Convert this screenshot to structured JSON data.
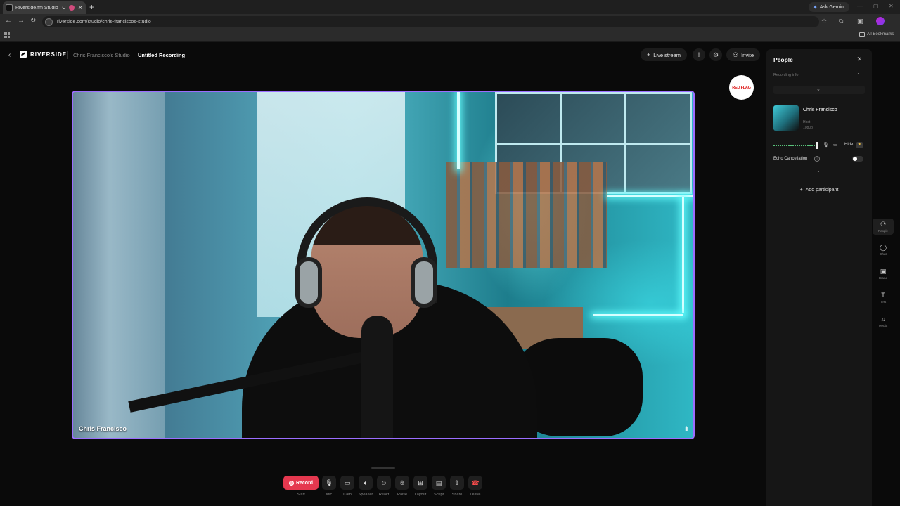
{
  "browser": {
    "tab_title": "Riverside.fm Studio | Chris F",
    "new_tab": "+",
    "ask_gemini": "Ask Gemini",
    "url": "riverside.com/studio/chris-franciscos-studio",
    "all_bookmarks": "All Bookmarks"
  },
  "header": {
    "brand": "RIVERSIDE",
    "studio_name": "Chris Francisco's Studio",
    "recording_name": "Untitled Recording",
    "live_stream": "Live stream",
    "invite": "Invite"
  },
  "stage": {
    "participant_name": "Chris Francisco",
    "overlay_logo_text": "RED FLAG"
  },
  "controls": [
    {
      "label": "Start",
      "button": "Record",
      "icon": "record-dot"
    },
    {
      "label": "Mic",
      "icon": "mic-icon"
    },
    {
      "label": "Cam",
      "icon": "camera-icon"
    },
    {
      "label": "Speaker",
      "icon": "speaker-icon"
    },
    {
      "label": "React",
      "icon": "emoji-icon"
    },
    {
      "label": "Raise",
      "icon": "hand-icon"
    },
    {
      "label": "Layout",
      "icon": "layout-icon"
    },
    {
      "label": "Script",
      "icon": "script-icon"
    },
    {
      "label": "Share",
      "icon": "share-icon"
    },
    {
      "label": "Leave",
      "icon": "phone-hangup-icon"
    }
  ],
  "people_panel": {
    "title": "People",
    "recording_info": "Recording info",
    "participant": {
      "name": "Chris Francisco",
      "role": "Host",
      "resolution": "1080p"
    },
    "hide": "Hide",
    "echo_cancellation": "Echo Cancellation",
    "add_participant": "Add participant"
  },
  "rail": [
    {
      "label": "People",
      "icon": "people-icon"
    },
    {
      "label": "Chat",
      "icon": "chat-icon"
    },
    {
      "label": "Brand",
      "icon": "brand-icon"
    },
    {
      "label": "Text",
      "icon": "text-icon"
    },
    {
      "label": "Media",
      "icon": "media-icon"
    }
  ],
  "colors": {
    "accent": "#9b6dff",
    "record": "#e5384f",
    "leave": "#ff4d4d"
  }
}
